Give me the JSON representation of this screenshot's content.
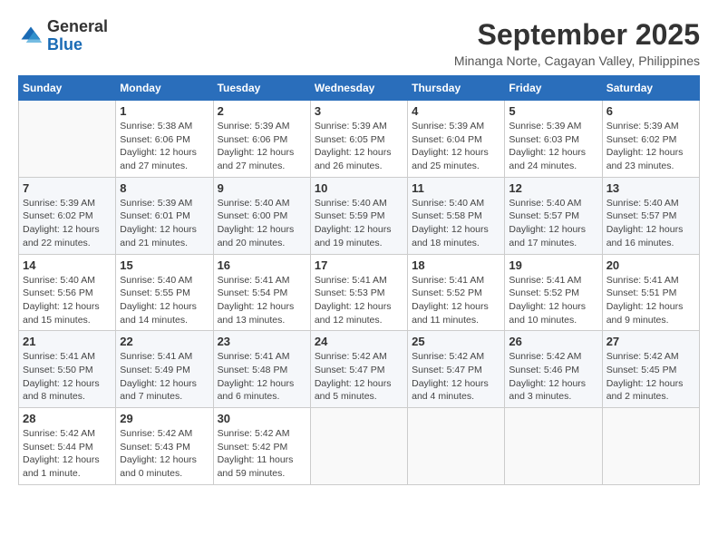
{
  "header": {
    "logo_line1": "General",
    "logo_line2": "Blue",
    "month_title": "September 2025",
    "subtitle": "Minanga Norte, Cagayan Valley, Philippines"
  },
  "weekdays": [
    "Sunday",
    "Monday",
    "Tuesday",
    "Wednesday",
    "Thursday",
    "Friday",
    "Saturday"
  ],
  "weeks": [
    [
      {
        "day": "",
        "info": ""
      },
      {
        "day": "1",
        "info": "Sunrise: 5:38 AM\nSunset: 6:06 PM\nDaylight: 12 hours\nand 27 minutes."
      },
      {
        "day": "2",
        "info": "Sunrise: 5:39 AM\nSunset: 6:06 PM\nDaylight: 12 hours\nand 27 minutes."
      },
      {
        "day": "3",
        "info": "Sunrise: 5:39 AM\nSunset: 6:05 PM\nDaylight: 12 hours\nand 26 minutes."
      },
      {
        "day": "4",
        "info": "Sunrise: 5:39 AM\nSunset: 6:04 PM\nDaylight: 12 hours\nand 25 minutes."
      },
      {
        "day": "5",
        "info": "Sunrise: 5:39 AM\nSunset: 6:03 PM\nDaylight: 12 hours\nand 24 minutes."
      },
      {
        "day": "6",
        "info": "Sunrise: 5:39 AM\nSunset: 6:02 PM\nDaylight: 12 hours\nand 23 minutes."
      }
    ],
    [
      {
        "day": "7",
        "info": "Sunrise: 5:39 AM\nSunset: 6:02 PM\nDaylight: 12 hours\nand 22 minutes."
      },
      {
        "day": "8",
        "info": "Sunrise: 5:39 AM\nSunset: 6:01 PM\nDaylight: 12 hours\nand 21 minutes."
      },
      {
        "day": "9",
        "info": "Sunrise: 5:40 AM\nSunset: 6:00 PM\nDaylight: 12 hours\nand 20 minutes."
      },
      {
        "day": "10",
        "info": "Sunrise: 5:40 AM\nSunset: 5:59 PM\nDaylight: 12 hours\nand 19 minutes."
      },
      {
        "day": "11",
        "info": "Sunrise: 5:40 AM\nSunset: 5:58 PM\nDaylight: 12 hours\nand 18 minutes."
      },
      {
        "day": "12",
        "info": "Sunrise: 5:40 AM\nSunset: 5:57 PM\nDaylight: 12 hours\nand 17 minutes."
      },
      {
        "day": "13",
        "info": "Sunrise: 5:40 AM\nSunset: 5:57 PM\nDaylight: 12 hours\nand 16 minutes."
      }
    ],
    [
      {
        "day": "14",
        "info": "Sunrise: 5:40 AM\nSunset: 5:56 PM\nDaylight: 12 hours\nand 15 minutes."
      },
      {
        "day": "15",
        "info": "Sunrise: 5:40 AM\nSunset: 5:55 PM\nDaylight: 12 hours\nand 14 minutes."
      },
      {
        "day": "16",
        "info": "Sunrise: 5:41 AM\nSunset: 5:54 PM\nDaylight: 12 hours\nand 13 minutes."
      },
      {
        "day": "17",
        "info": "Sunrise: 5:41 AM\nSunset: 5:53 PM\nDaylight: 12 hours\nand 12 minutes."
      },
      {
        "day": "18",
        "info": "Sunrise: 5:41 AM\nSunset: 5:52 PM\nDaylight: 12 hours\nand 11 minutes."
      },
      {
        "day": "19",
        "info": "Sunrise: 5:41 AM\nSunset: 5:52 PM\nDaylight: 12 hours\nand 10 minutes."
      },
      {
        "day": "20",
        "info": "Sunrise: 5:41 AM\nSunset: 5:51 PM\nDaylight: 12 hours\nand 9 minutes."
      }
    ],
    [
      {
        "day": "21",
        "info": "Sunrise: 5:41 AM\nSunset: 5:50 PM\nDaylight: 12 hours\nand 8 minutes."
      },
      {
        "day": "22",
        "info": "Sunrise: 5:41 AM\nSunset: 5:49 PM\nDaylight: 12 hours\nand 7 minutes."
      },
      {
        "day": "23",
        "info": "Sunrise: 5:41 AM\nSunset: 5:48 PM\nDaylight: 12 hours\nand 6 minutes."
      },
      {
        "day": "24",
        "info": "Sunrise: 5:42 AM\nSunset: 5:47 PM\nDaylight: 12 hours\nand 5 minutes."
      },
      {
        "day": "25",
        "info": "Sunrise: 5:42 AM\nSunset: 5:47 PM\nDaylight: 12 hours\nand 4 minutes."
      },
      {
        "day": "26",
        "info": "Sunrise: 5:42 AM\nSunset: 5:46 PM\nDaylight: 12 hours\nand 3 minutes."
      },
      {
        "day": "27",
        "info": "Sunrise: 5:42 AM\nSunset: 5:45 PM\nDaylight: 12 hours\nand 2 minutes."
      }
    ],
    [
      {
        "day": "28",
        "info": "Sunrise: 5:42 AM\nSunset: 5:44 PM\nDaylight: 12 hours\nand 1 minute."
      },
      {
        "day": "29",
        "info": "Sunrise: 5:42 AM\nSunset: 5:43 PM\nDaylight: 12 hours\nand 0 minutes."
      },
      {
        "day": "30",
        "info": "Sunrise: 5:42 AM\nSunset: 5:42 PM\nDaylight: 11 hours\nand 59 minutes."
      },
      {
        "day": "",
        "info": ""
      },
      {
        "day": "",
        "info": ""
      },
      {
        "day": "",
        "info": ""
      },
      {
        "day": "",
        "info": ""
      }
    ]
  ]
}
